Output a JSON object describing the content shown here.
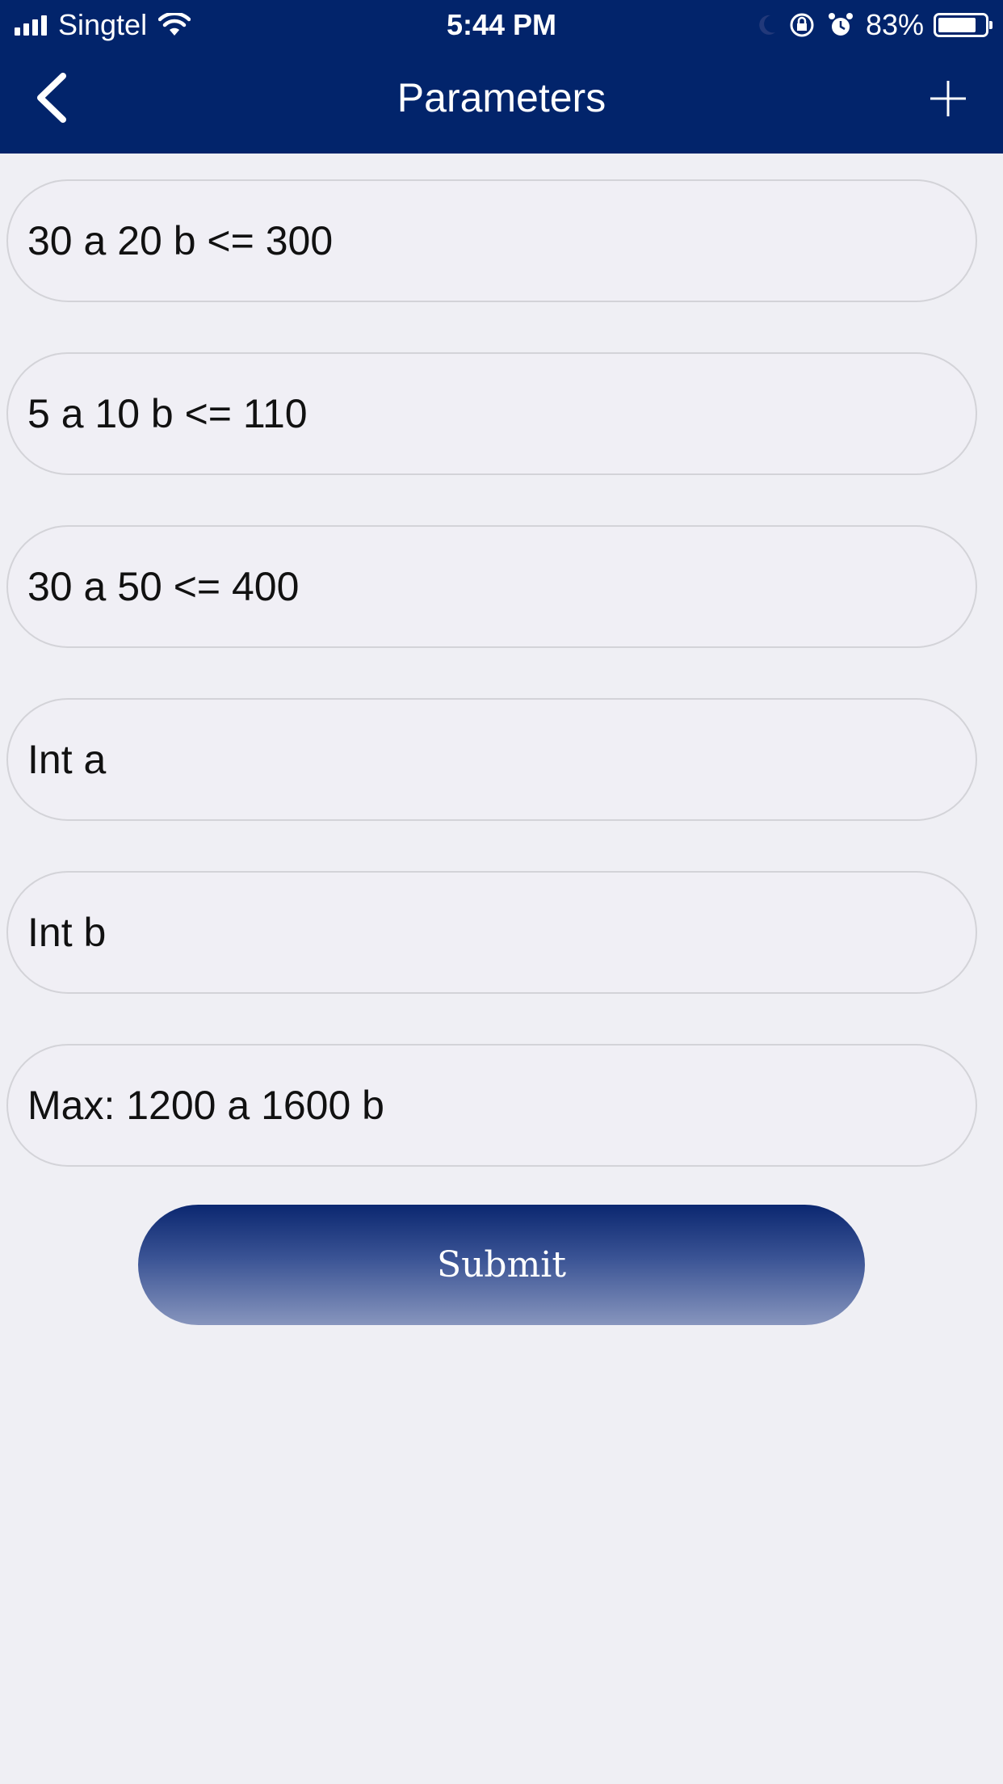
{
  "status_bar": {
    "carrier": "Singtel",
    "time": "5:44 PM",
    "battery": "83%",
    "battery_level": 0.83,
    "icons": [
      "signal-icon",
      "wifi-icon",
      "moon-icon",
      "orientation-lock-icon",
      "alarm-icon",
      "battery-icon"
    ]
  },
  "header": {
    "title": "Parameters",
    "back_icon": "chevron-left-icon",
    "add_icon": "plus-icon"
  },
  "fields": [
    {
      "value": "30 a 20 b <= 300"
    },
    {
      "value": "5 a 10 b <= 110"
    },
    {
      "value": "30 a 50 <= 400"
    },
    {
      "value": "Int a"
    },
    {
      "value": "Int b"
    },
    {
      "value": "Max: 1200 a 1600 b"
    }
  ],
  "submit": {
    "label": "Submit"
  },
  "colors": {
    "header_bg": "#02246b",
    "page_bg": "#efeff4",
    "field_border": "#d3d3d8"
  }
}
